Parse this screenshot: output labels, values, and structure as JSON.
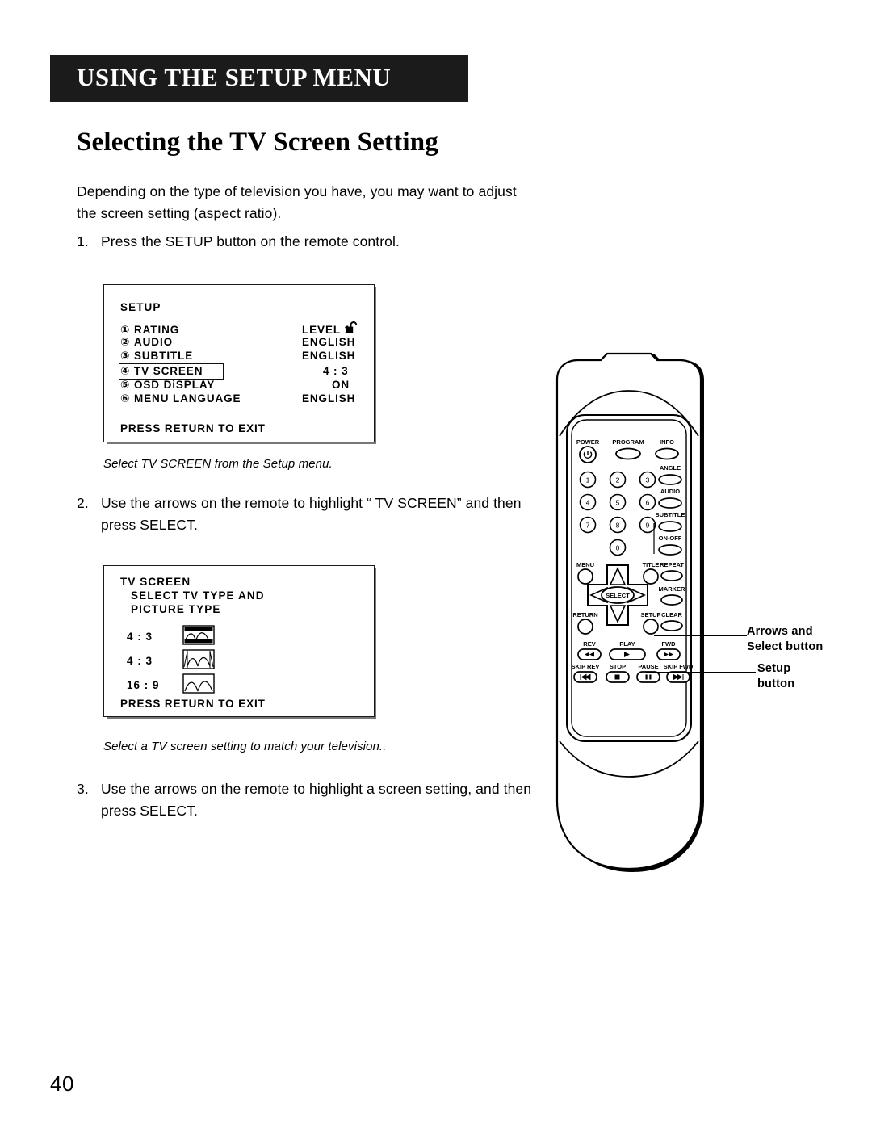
{
  "header": {
    "banner_title": "USING THE SETUP MENU",
    "section_heading": "Selecting the TV Screen Setting"
  },
  "intro": "Depending on the type of television you have, you may want to adjust the screen setting (aspect ratio).",
  "steps": [
    {
      "number": "1.",
      "text": "Press the SETUP button on the remote control."
    },
    {
      "number": "2.",
      "text": "Use the arrows on the remote to highlight “ TV SCREEN” and then press SELECT."
    },
    {
      "number": "3.",
      "text": "Use the arrows on the remote to highlight a screen setting, and then press SELECT."
    }
  ],
  "captions": {
    "setup_menu": "Select TV SCREEN from the Setup menu.",
    "tv_screen_menu": "Select a TV screen setting to match your television.."
  },
  "osd_setup": {
    "title": "SETUP",
    "rows": [
      {
        "marker": "①",
        "label": "RATING",
        "value": "LEVEL 1",
        "highlighted": false,
        "lock_icon": "unlocked-padlock-icon"
      },
      {
        "marker": "②",
        "label": "AUDIO",
        "value": "ENGLISH",
        "highlighted": false
      },
      {
        "marker": "③",
        "label": "SUBTITLE",
        "value": "ENGLISH",
        "highlighted": false
      },
      {
        "marker": "④",
        "label": "TV SCREEN",
        "value": "4 : 3",
        "highlighted": true
      },
      {
        "marker": "⑤",
        "label": "OSD DiSPLAY",
        "value": "ON",
        "highlighted": false
      },
      {
        "marker": "⑥",
        "label": "MENU LANGUAGE",
        "value": "ENGLISH",
        "highlighted": false
      }
    ],
    "footer": "PRESS RETURN TO EXIT"
  },
  "osd_tv_screen": {
    "title": "TV SCREEN",
    "subtitle_line1": "SELECT TV TYPE AND",
    "subtitle_line2": "PICTURE TYPE",
    "options": [
      {
        "ratio": "4 : 3",
        "icon": "letterbox-screen-icon"
      },
      {
        "ratio": "4 : 3",
        "icon": "pan-scan-screen-icon"
      },
      {
        "ratio": "16 : 9",
        "icon": "widescreen-screen-icon"
      }
    ],
    "footer": "PRESS RETURN TO EXIT"
  },
  "remote": {
    "buttons": {
      "power": "POWER",
      "program": "PROGRAM",
      "info": "INFO",
      "angle": "ANGLE",
      "audio": "AUDIO",
      "subtitle": "SUBTITLE",
      "on_off": "ON-OFF",
      "menu": "MENU",
      "title": "TITLE",
      "repeat": "REPEAT",
      "marker": "MARKER",
      "return": "RETURN",
      "setup": "SETUP",
      "clear": "CLEAR",
      "select": "SELECT",
      "rev": "REV",
      "play": "PLAY",
      "fwd": "FWD",
      "skip_rev": "SKIP REV",
      "stop": "STOP",
      "pause": "PAUSE",
      "skip_fwd": "SKIP FWD"
    },
    "keypad": [
      "1",
      "2",
      "3",
      "4",
      "5",
      "6",
      "7",
      "8",
      "9",
      "0"
    ]
  },
  "callouts": {
    "arrows_select_line1": "Arrows and",
    "arrows_select_line2": "Select button",
    "setup_line1": "Setup",
    "setup_line2": "button"
  },
  "page_number": "40"
}
